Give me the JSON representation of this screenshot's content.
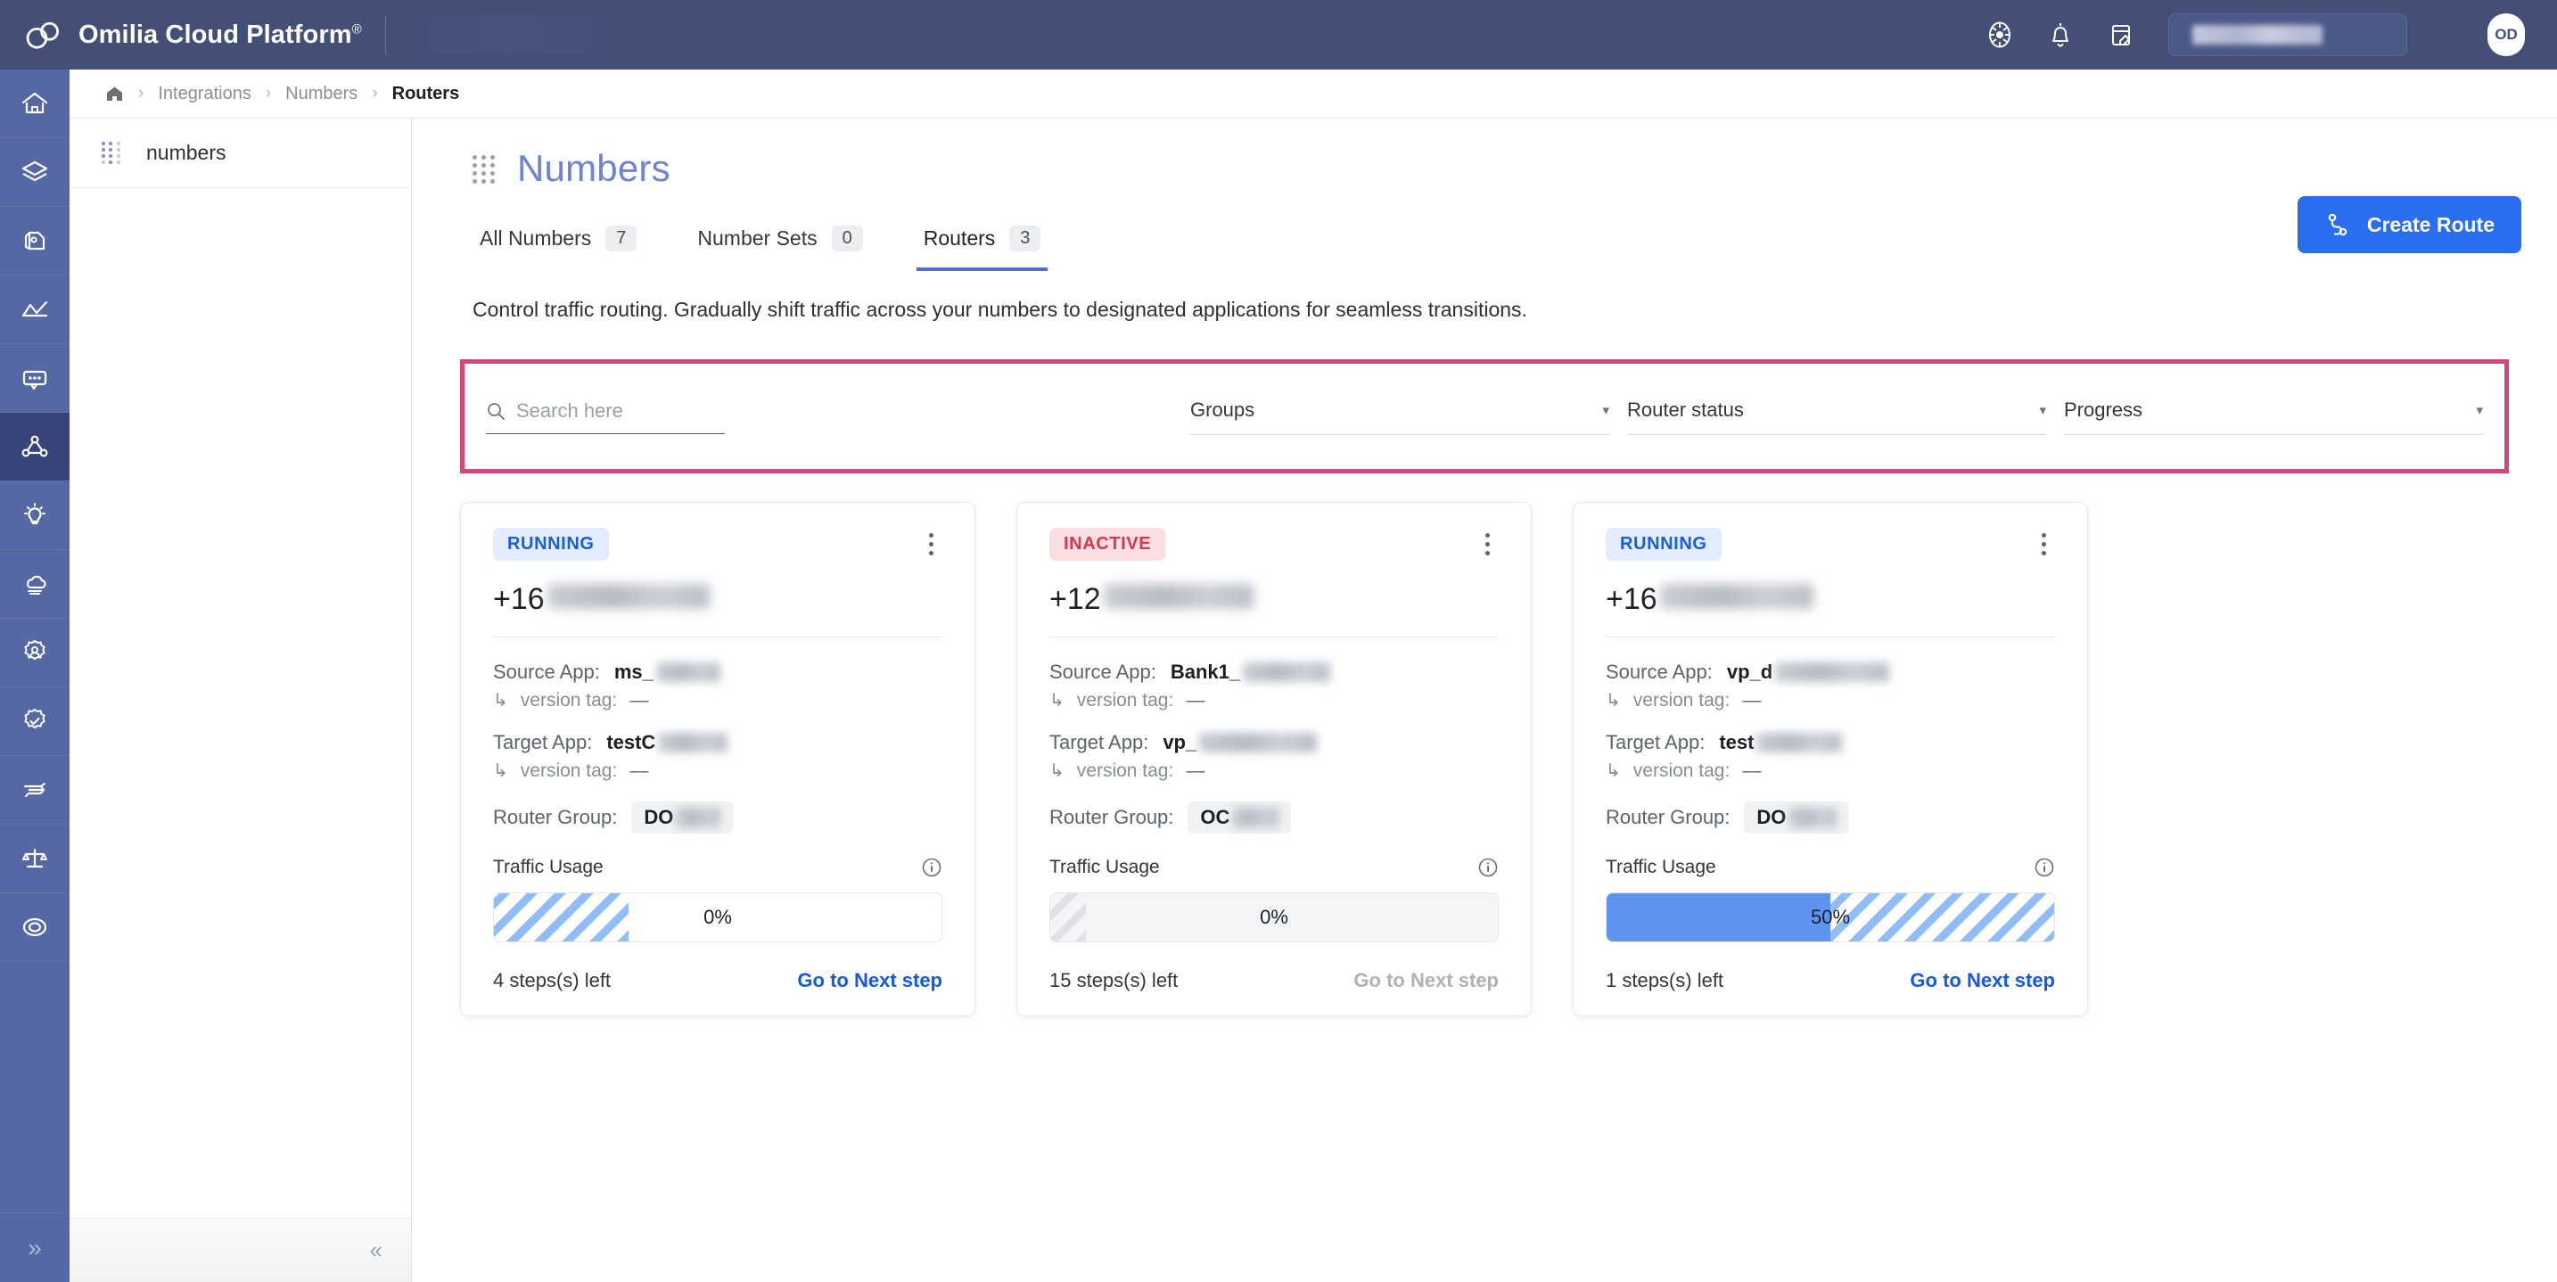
{
  "topbar": {
    "brand": "Omilia Cloud Platform",
    "brand_mark": "®",
    "avatar_initials": "OD",
    "icons": [
      "support-wheel-icon",
      "bell-icon",
      "notes-edit-icon"
    ]
  },
  "rail": {
    "items": [
      {
        "name": "home",
        "active": false
      },
      {
        "name": "layers",
        "active": false
      },
      {
        "name": "flows",
        "active": false
      },
      {
        "name": "analytics",
        "active": false
      },
      {
        "name": "conversations",
        "active": false
      },
      {
        "name": "integrations",
        "active": true
      },
      {
        "name": "insights",
        "active": false
      },
      {
        "name": "cloud",
        "active": false
      },
      {
        "name": "user-settings",
        "active": false
      },
      {
        "name": "quality",
        "active": false
      },
      {
        "name": "data-streams",
        "active": false
      },
      {
        "name": "compliance",
        "active": false
      },
      {
        "name": "support",
        "active": false
      }
    ],
    "expand_glyph": "»"
  },
  "breadcrumb": {
    "home_label": "Home",
    "separator": "›",
    "items": [
      "Integrations",
      "Numbers",
      "Routers"
    ]
  },
  "tree": {
    "items": [
      {
        "label": "numbers"
      }
    ],
    "collapse_glyph": "«"
  },
  "page": {
    "title": "Numbers",
    "description": "Control traffic routing. Gradually shift traffic across your numbers to designated applications for seamless transitions."
  },
  "tabs": [
    {
      "label": "All Numbers",
      "count": "7",
      "active": false
    },
    {
      "label": "Number Sets",
      "count": "0",
      "active": false
    },
    {
      "label": "Routers",
      "count": "3",
      "active": true
    }
  ],
  "actions": {
    "create_route": "Create Route"
  },
  "filters": {
    "search": {
      "value": "",
      "placeholder": "Search here"
    },
    "selects": [
      {
        "label": "Groups",
        "value": ""
      },
      {
        "label": "Router status",
        "value": ""
      },
      {
        "label": "Progress",
        "value": ""
      }
    ],
    "highlight_color": "#d6457b"
  },
  "labels": {
    "source_app": "Source App:",
    "target_app": "Target App:",
    "version_tag": "version tag:",
    "router_group": "Router Group:",
    "traffic_usage": "Traffic Usage",
    "next_step": "Go to Next step",
    "version_tag_value": "—",
    "return_arrow": "↳"
  },
  "cards": [
    {
      "status": "RUNNING",
      "status_kind": "running",
      "phone_prefix": "+16",
      "phone_redacted_width": 182,
      "source_app_prefix": "ms_",
      "source_app_redacted_width": 72,
      "target_app_prefix": "testC",
      "target_app_redacted_width": 78,
      "router_group_prefix": "DO",
      "router_group_redacted_width": 50,
      "traffic_percent": "0%",
      "fill_pct": 0,
      "stripe_start_pct": 0,
      "stripe_end_pct": 30,
      "bar_enabled": true,
      "steps_left": "4 steps(s) left",
      "next_enabled": true
    },
    {
      "status": "INACTIVE",
      "status_kind": "inactive",
      "phone_prefix": "+12",
      "phone_redacted_width": 168,
      "source_app_prefix": "Bank1_",
      "source_app_redacted_width": 98,
      "target_app_prefix": "vp_",
      "target_app_redacted_width": 132,
      "router_group_prefix": "OC",
      "router_group_redacted_width": 52,
      "traffic_percent": "0%",
      "fill_pct": 0,
      "stripe_start_pct": 0,
      "stripe_end_pct": 8,
      "bar_enabled": false,
      "steps_left": "15 steps(s) left",
      "next_enabled": false
    },
    {
      "status": "RUNNING",
      "status_kind": "running",
      "phone_prefix": "+16",
      "phone_redacted_width": 172,
      "source_app_prefix": "vp_d",
      "source_app_redacted_width": 128,
      "target_app_prefix": "test",
      "target_app_redacted_width": 96,
      "router_group_prefix": "DO",
      "router_group_redacted_width": 54,
      "traffic_percent": "50%",
      "fill_pct": 50,
      "stripe_start_pct": 50,
      "stripe_end_pct": 100,
      "bar_enabled": true,
      "steps_left": "1 steps(s) left",
      "next_enabled": true
    }
  ]
}
